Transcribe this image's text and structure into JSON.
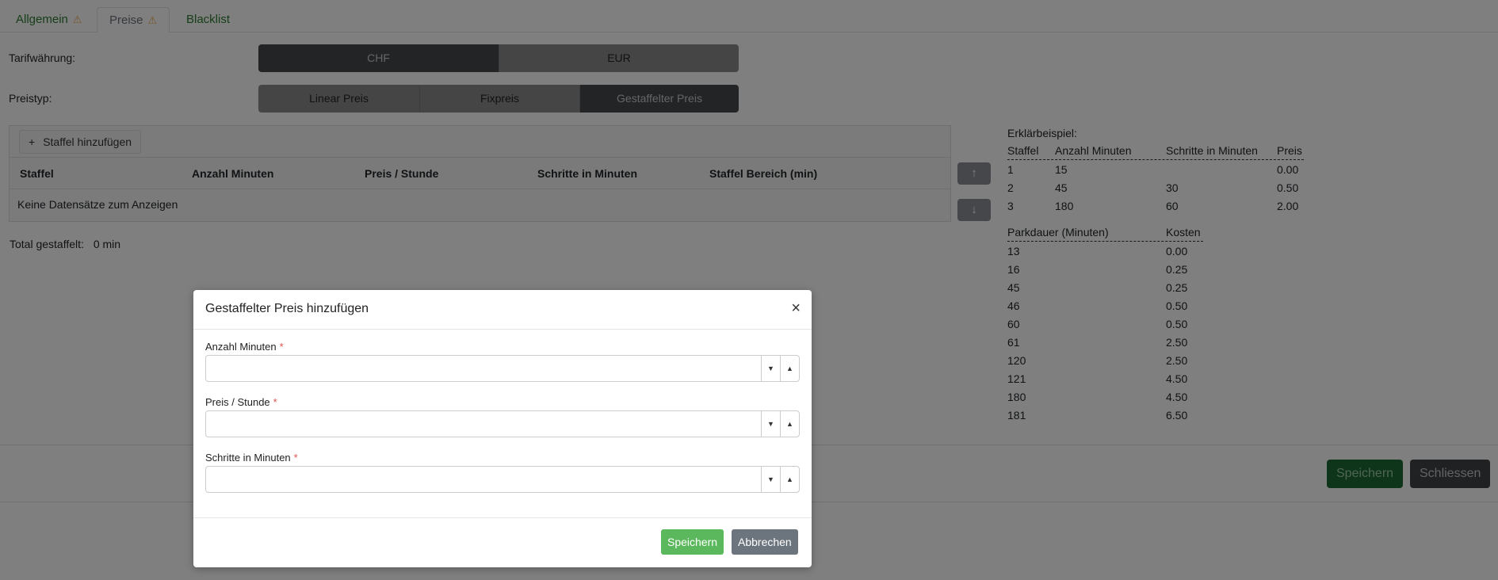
{
  "tabs": [
    {
      "label": "Allgemein",
      "warning": true
    },
    {
      "label": "Preise",
      "warning": true
    },
    {
      "label": "Blacklist",
      "warning": false
    }
  ],
  "warning_icon": "⚠",
  "currency": {
    "label": "Tarifwährung:",
    "options": [
      "CHF",
      "EUR"
    ],
    "selected": "CHF"
  },
  "price_type": {
    "label": "Preistyp:",
    "options": [
      "Linear Preis",
      "Fixpreis",
      "Gestaffelter Preis"
    ],
    "selected": "Gestaffelter Preis"
  },
  "grid": {
    "add_label": "Staffel hinzufügen",
    "columns": [
      "Staffel",
      "Anzahl Minuten",
      "Preis / Stunde",
      "Schritte in Minuten",
      "Staffel Bereich (min)"
    ],
    "empty_text": "Keine Datensätze zum Anzeigen"
  },
  "total": {
    "label": "Total gestaffelt:",
    "value": "0 min"
  },
  "example": {
    "title": "Erklärbeispiel:",
    "headers": [
      "Staffel",
      "Anzahl Minuten",
      "Schritte in Minuten",
      "Preis"
    ],
    "rows": [
      [
        "1",
        "15",
        "",
        "0.00"
      ],
      [
        "2",
        "45",
        "30",
        "0.50"
      ],
      [
        "3",
        "180",
        "60",
        "2.00"
      ]
    ],
    "cost_headers": [
      "Parkdauer (Minuten)",
      "Kosten"
    ],
    "cost_rows": [
      [
        "13",
        "0.00"
      ],
      [
        "16",
        "0.25"
      ],
      [
        "45",
        "0.25"
      ],
      [
        "46",
        "0.50"
      ],
      [
        "60",
        "0.50"
      ],
      [
        "61",
        "2.50"
      ],
      [
        "120",
        "2.50"
      ],
      [
        "121",
        "4.50"
      ],
      [
        "180",
        "4.50"
      ],
      [
        "181",
        "6.50"
      ]
    ]
  },
  "footer": {
    "save": "Speichern",
    "close": "Schliessen"
  },
  "modal": {
    "title": "Gestaffelter Preis hinzufügen",
    "close": "×",
    "fields": [
      {
        "label": "Anzahl Minuten",
        "required": "*",
        "value": ""
      },
      {
        "label": "Preis / Stunde",
        "required": "*",
        "value": ""
      },
      {
        "label": "Schritte in Minuten",
        "required": "*",
        "value": ""
      }
    ],
    "save": "Speichern",
    "cancel": "Abbrechen"
  }
}
